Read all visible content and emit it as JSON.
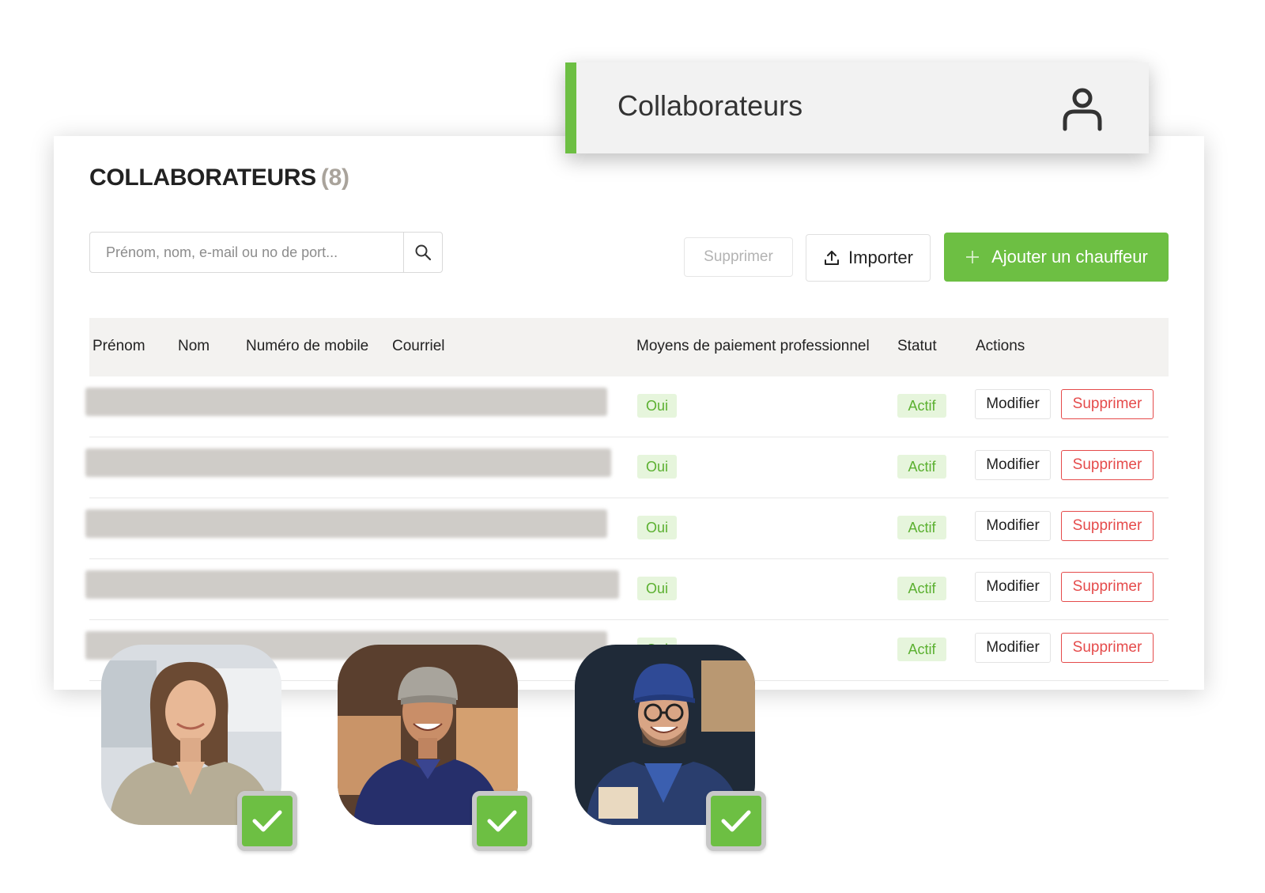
{
  "header_tab": {
    "title": "Collaborateurs",
    "icon": "user-icon"
  },
  "page": {
    "title": "COLLABORATEURS",
    "count": "(8)"
  },
  "search": {
    "placeholder": "Prénom, nom, e-mail ou no de port..."
  },
  "toolbar": {
    "delete_label": "Supprimer",
    "import_label": "Importer",
    "add_label": "Ajouter un chauffeur"
  },
  "table": {
    "columns": [
      "Prénom",
      "Nom",
      "Numéro de mobile",
      "Courriel",
      "Moyens de paiement professionnel",
      "Statut",
      "Actions"
    ],
    "rows": [
      {
        "payment": "Oui",
        "status": "Actif",
        "edit": "Modifier",
        "delete": "Supprimer"
      },
      {
        "payment": "Oui",
        "status": "Actif",
        "edit": "Modifier",
        "delete": "Supprimer"
      },
      {
        "payment": "Oui",
        "status": "Actif",
        "edit": "Modifier",
        "delete": "Supprimer"
      },
      {
        "payment": "Oui",
        "status": "Actif",
        "edit": "Modifier",
        "delete": "Supprimer"
      },
      {
        "payment": "Oui",
        "status": "Actif",
        "edit": "Modifier",
        "delete": "Supprimer"
      }
    ]
  },
  "colors": {
    "accent": "#6dbf43",
    "danger": "#e54b4b",
    "muted": "#a9a39b"
  }
}
